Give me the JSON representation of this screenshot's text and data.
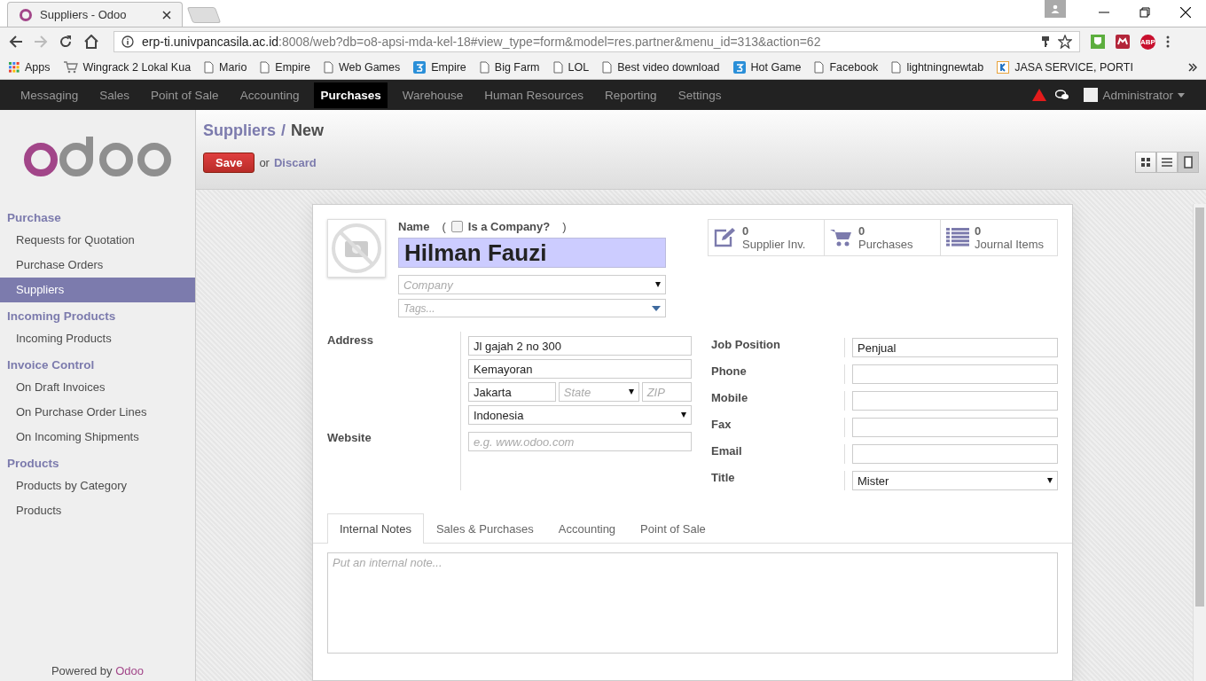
{
  "browser": {
    "tab_title": "Suppliers - Odoo",
    "url_host": "erp-ti.univpancasila.ac.id",
    "url_rest": ":8008/web?db=o8-apsi-mda-kel-18#view_type=form&model=res.partner&menu_id=313&action=62",
    "extensions": [
      {
        "kind": "shield"
      },
      {
        "kind": "mask"
      },
      {
        "kind": "abp",
        "label": "ABP"
      }
    ],
    "bookmarks": [
      {
        "kind": "apps",
        "label": "Apps"
      },
      {
        "kind": "cart",
        "label": "Wingrack 2 Lokal Kua"
      },
      {
        "kind": "page",
        "label": "Mario"
      },
      {
        "kind": "page",
        "label": "Empire"
      },
      {
        "kind": "page",
        "label": "Web Games"
      },
      {
        "kind": "three",
        "label": "Empire"
      },
      {
        "kind": "page",
        "label": "Big Farm"
      },
      {
        "kind": "page",
        "label": "LOL"
      },
      {
        "kind": "page",
        "label": "Best video download"
      },
      {
        "kind": "three",
        "label": "Hot Game"
      },
      {
        "kind": "page",
        "label": "Facebook"
      },
      {
        "kind": "page",
        "label": "lightningnewtab"
      },
      {
        "kind": "k",
        "label": "JASA SERVICE, PORTI"
      }
    ]
  },
  "topnav": {
    "menus": [
      {
        "label": "Messaging",
        "selected": false
      },
      {
        "label": "Sales",
        "selected": false
      },
      {
        "label": "Point of Sale",
        "selected": false
      },
      {
        "label": "Accounting",
        "selected": false
      },
      {
        "label": "Purchases",
        "selected": true
      },
      {
        "label": "Warehouse",
        "selected": false
      },
      {
        "label": "Human Resources",
        "selected": false
      },
      {
        "label": "Reporting",
        "selected": false
      },
      {
        "label": "Settings",
        "selected": false
      }
    ],
    "user": "Administrator"
  },
  "sidebar": {
    "sections": [
      {
        "title": "Purchase",
        "items": [
          {
            "label": "Requests for Quotation",
            "selected": false
          },
          {
            "label": "Purchase Orders",
            "selected": false
          },
          {
            "label": "Suppliers",
            "selected": true
          }
        ]
      },
      {
        "title": "Incoming Products",
        "items": [
          {
            "label": "Incoming Products",
            "selected": false
          }
        ]
      },
      {
        "title": "Invoice Control",
        "items": [
          {
            "label": "On Draft Invoices",
            "selected": false
          },
          {
            "label": "On Purchase Order Lines",
            "selected": false
          },
          {
            "label": "On Incoming Shipments",
            "selected": false
          }
        ]
      },
      {
        "title": "Products",
        "items": [
          {
            "label": "Products by Category",
            "selected": false
          },
          {
            "label": "Products",
            "selected": false
          }
        ]
      }
    ],
    "footer_text": "Powered by",
    "footer_link": "Odoo"
  },
  "breadcrumb": {
    "parent": "Suppliers",
    "separator": "/",
    "current": "New"
  },
  "actions": {
    "save": "Save",
    "or": "or",
    "discard": "Discard"
  },
  "view_switcher": [
    {
      "kind": "kanban",
      "selected": false
    },
    {
      "kind": "list",
      "selected": false
    },
    {
      "kind": "form",
      "selected": true
    }
  ],
  "form": {
    "name_label": "Name",
    "paren_open": "(",
    "is_company": {
      "label": "Is a Company?",
      "checked": false
    },
    "paren_close": ")",
    "name_value": "Hilman Fauzi",
    "company_placeholder": "Company",
    "tags_placeholder": "Tags...",
    "stat_buttons": [
      {
        "kind": "edit",
        "count": "0",
        "label": "Supplier Inv."
      },
      {
        "kind": "cart",
        "count": "0",
        "label": "Purchases"
      },
      {
        "kind": "list",
        "count": "0",
        "label": "Journal Items"
      }
    ],
    "address_label": "Address",
    "street": "Jl gajah 2 no 300",
    "street2": "Kemayoran",
    "city": "Jakarta",
    "state_placeholder": "State",
    "zip_placeholder": "ZIP",
    "country": "Indonesia",
    "website_label": "Website",
    "website_placeholder": "e.g. www.odoo.com",
    "right_fields": [
      {
        "kind": "text",
        "label": "Job Position",
        "value": "Penjual"
      },
      {
        "kind": "text",
        "label": "Phone"
      },
      {
        "kind": "text",
        "label": "Mobile"
      },
      {
        "kind": "text",
        "label": "Fax"
      },
      {
        "kind": "text",
        "label": "Email"
      },
      {
        "kind": "select",
        "label": "Title",
        "value": "Mister"
      }
    ],
    "tabs": [
      {
        "label": "Internal Notes",
        "selected": true
      },
      {
        "label": "Sales & Purchases",
        "selected": false
      },
      {
        "label": "Accounting",
        "selected": false
      },
      {
        "label": "Point of Sale",
        "selected": false
      }
    ],
    "note_placeholder": "Put an internal note..."
  }
}
